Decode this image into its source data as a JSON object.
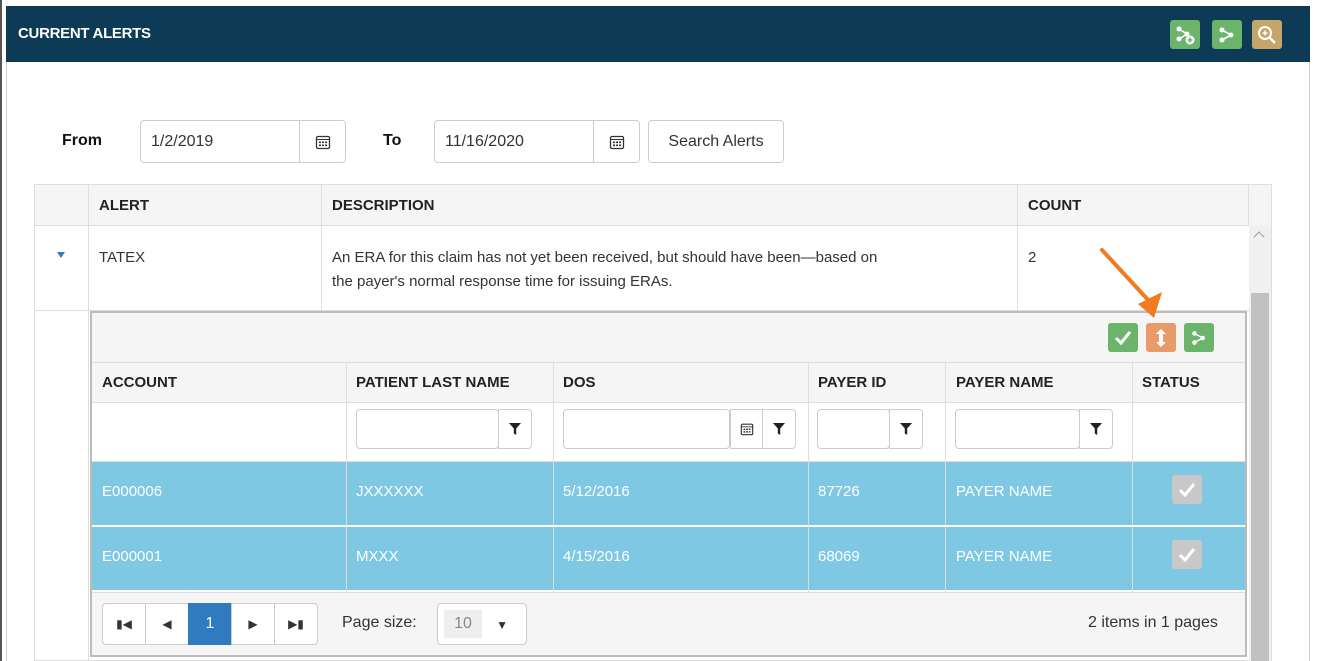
{
  "header": {
    "title": "CURRENT ALERTS",
    "icons": [
      "add-tree-icon",
      "tree-icon",
      "zoom-icon"
    ]
  },
  "search": {
    "from_label": "From",
    "from_value": "1/2/2019",
    "to_label": "To",
    "to_value": "11/16/2020",
    "button_label": "Search Alerts"
  },
  "alerts_grid": {
    "columns": [
      "ALERT",
      "DESCRIPTION",
      "COUNT"
    ],
    "rows": [
      {
        "alert": "TATEX",
        "description_line1": "An ERA for this claim has not yet been received, but should have been—based on",
        "description_line2": "the payer's normal response time for issuing ERAs.",
        "count": "2"
      }
    ]
  },
  "detail_grid": {
    "toolbar_icons": [
      "check-icon",
      "expand-icon",
      "tree-icon"
    ],
    "columns": [
      "ACCOUNT",
      "PATIENT LAST NAME",
      "DOS",
      "PAYER ID",
      "PAYER NAME",
      "STATUS"
    ],
    "rows": [
      {
        "account": "E000006",
        "patient_last_name": "JXXXXXX",
        "dos": "5/12/2016",
        "payer_id": "87726",
        "payer_name": "PAYER NAME"
      },
      {
        "account": "E000001",
        "patient_last_name": "MXXX",
        "dos": "4/15/2016",
        "payer_id": "68069",
        "payer_name": "PAYER NAME"
      }
    ],
    "pager": {
      "current_page": "1",
      "page_size_label": "Page size:",
      "page_size": "10",
      "summary": "2 items in 1 pages"
    }
  },
  "colors": {
    "header_bg": "#0d3a55",
    "selected_row": "#7ec8e3",
    "green_button": "#6cb36c",
    "orange_button": "#e89a6a",
    "tan_button": "#c4a56a",
    "arrow": "#f07b22",
    "pager_active": "#2f7bbf"
  }
}
